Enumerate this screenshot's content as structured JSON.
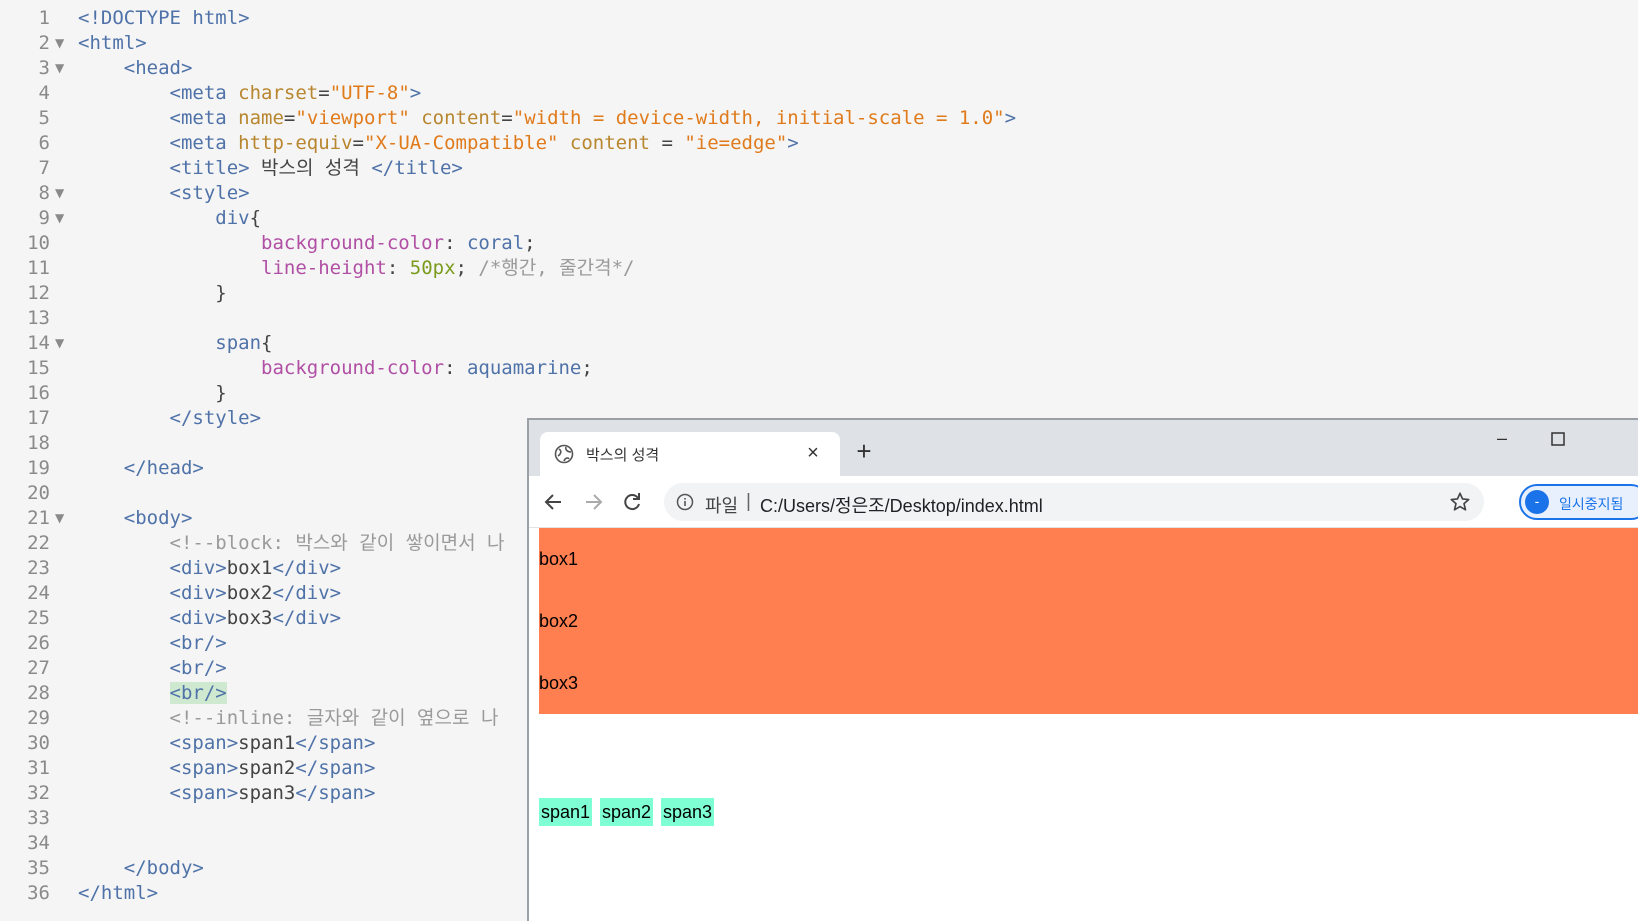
{
  "editor": {
    "lines": [
      {
        "num": "1",
        "fold": "",
        "parts": [
          [
            "t-tag",
            "<!DOCTYPE html>"
          ]
        ]
      },
      {
        "num": "2",
        "fold": "▼",
        "parts": [
          [
            "t-tag",
            "<html>"
          ]
        ]
      },
      {
        "num": "3",
        "fold": "▼",
        "parts": [
          [
            "t-txt",
            "    "
          ],
          [
            "t-tag",
            "<head>"
          ]
        ]
      },
      {
        "num": "4",
        "fold": "",
        "parts": [
          [
            "t-txt",
            "        "
          ],
          [
            "t-tag",
            "<meta "
          ],
          [
            "t-attr",
            "charset"
          ],
          [
            "t-txt",
            "="
          ],
          [
            "t-str",
            "\"UTF-8\""
          ],
          [
            "t-tag",
            ">"
          ]
        ]
      },
      {
        "num": "5",
        "fold": "",
        "parts": [
          [
            "t-txt",
            "        "
          ],
          [
            "t-tag",
            "<meta "
          ],
          [
            "t-attr",
            "name"
          ],
          [
            "t-txt",
            "="
          ],
          [
            "t-str",
            "\"viewport\""
          ],
          [
            "t-txt",
            " "
          ],
          [
            "t-attr",
            "content"
          ],
          [
            "t-txt",
            "="
          ],
          [
            "t-str",
            "\"width = device-width, initial-scale = 1.0\""
          ],
          [
            "t-tag",
            ">"
          ]
        ]
      },
      {
        "num": "6",
        "fold": "",
        "parts": [
          [
            "t-txt",
            "        "
          ],
          [
            "t-tag",
            "<meta "
          ],
          [
            "t-attr",
            "http-equiv"
          ],
          [
            "t-txt",
            "="
          ],
          [
            "t-str",
            "\"X-UA-Compatible\""
          ],
          [
            "t-txt",
            " "
          ],
          [
            "t-attr",
            "content"
          ],
          [
            "t-txt",
            " = "
          ],
          [
            "t-str",
            "\"ie=edge\""
          ],
          [
            "t-tag",
            ">"
          ]
        ]
      },
      {
        "num": "7",
        "fold": "",
        "parts": [
          [
            "t-txt",
            "        "
          ],
          [
            "t-tag",
            "<title>"
          ],
          [
            "t-txt",
            " 박스의 성격 "
          ],
          [
            "t-tag",
            "</title>"
          ]
        ]
      },
      {
        "num": "8",
        "fold": "▼",
        "parts": [
          [
            "t-txt",
            "        "
          ],
          [
            "t-tag",
            "<style>"
          ]
        ]
      },
      {
        "num": "9",
        "fold": "▼",
        "parts": [
          [
            "t-txt",
            "            "
          ],
          [
            "t-sel",
            "div"
          ],
          [
            "t-txt",
            "{"
          ]
        ]
      },
      {
        "num": "10",
        "fold": "",
        "parts": [
          [
            "t-txt",
            "                "
          ],
          [
            "t-prop",
            "background-color"
          ],
          [
            "t-txt",
            ": "
          ],
          [
            "t-val",
            "coral"
          ],
          [
            "t-txt",
            ";"
          ]
        ]
      },
      {
        "num": "11",
        "fold": "",
        "parts": [
          [
            "t-txt",
            "                "
          ],
          [
            "t-prop",
            "line-height"
          ],
          [
            "t-txt",
            ": "
          ],
          [
            "t-num",
            "50px"
          ],
          [
            "t-txt",
            "; "
          ],
          [
            "t-com",
            "/*행간, 줄간격*/"
          ]
        ]
      },
      {
        "num": "12",
        "fold": "",
        "parts": [
          [
            "t-txt",
            "            }"
          ]
        ]
      },
      {
        "num": "13",
        "fold": "",
        "parts": [
          [
            "t-txt",
            ""
          ]
        ]
      },
      {
        "num": "14",
        "fold": "▼",
        "parts": [
          [
            "t-txt",
            "            "
          ],
          [
            "t-sel",
            "span"
          ],
          [
            "t-txt",
            "{"
          ]
        ]
      },
      {
        "num": "15",
        "fold": "",
        "parts": [
          [
            "t-txt",
            "                "
          ],
          [
            "t-prop",
            "background-color"
          ],
          [
            "t-txt",
            ": "
          ],
          [
            "t-val",
            "aquamarine"
          ],
          [
            "t-txt",
            ";"
          ]
        ]
      },
      {
        "num": "16",
        "fold": "",
        "parts": [
          [
            "t-txt",
            "            }"
          ]
        ]
      },
      {
        "num": "17",
        "fold": "",
        "parts": [
          [
            "t-txt",
            "        "
          ],
          [
            "t-tag",
            "</style>"
          ]
        ]
      },
      {
        "num": "18",
        "fold": "",
        "parts": [
          [
            "t-txt",
            ""
          ]
        ]
      },
      {
        "num": "19",
        "fold": "",
        "parts": [
          [
            "t-txt",
            "    "
          ],
          [
            "t-tag",
            "</head>"
          ]
        ]
      },
      {
        "num": "20",
        "fold": "",
        "parts": [
          [
            "t-txt",
            ""
          ]
        ]
      },
      {
        "num": "21",
        "fold": "▼",
        "parts": [
          [
            "t-txt",
            "    "
          ],
          [
            "t-tag",
            "<body>"
          ]
        ]
      },
      {
        "num": "22",
        "fold": "",
        "parts": [
          [
            "t-txt",
            "        "
          ],
          [
            "t-com",
            "<!--block: 박스와 같이 쌓이면서 나"
          ]
        ]
      },
      {
        "num": "23",
        "fold": "",
        "parts": [
          [
            "t-txt",
            "        "
          ],
          [
            "t-tag",
            "<div>"
          ],
          [
            "t-txt",
            "box1"
          ],
          [
            "t-tag",
            "</div>"
          ]
        ]
      },
      {
        "num": "24",
        "fold": "",
        "parts": [
          [
            "t-txt",
            "        "
          ],
          [
            "t-tag",
            "<div>"
          ],
          [
            "t-txt",
            "box2"
          ],
          [
            "t-tag",
            "</div>"
          ]
        ]
      },
      {
        "num": "25",
        "fold": "",
        "parts": [
          [
            "t-txt",
            "        "
          ],
          [
            "t-tag",
            "<div>"
          ],
          [
            "t-txt",
            "box3"
          ],
          [
            "t-tag",
            "</div>"
          ]
        ]
      },
      {
        "num": "26",
        "fold": "",
        "parts": [
          [
            "t-txt",
            "        "
          ],
          [
            "t-tag",
            "<br/>"
          ]
        ]
      },
      {
        "num": "27",
        "fold": "",
        "parts": [
          [
            "t-txt",
            "        "
          ],
          [
            "t-tag",
            "<br/>"
          ]
        ]
      },
      {
        "num": "28",
        "fold": "",
        "parts": [
          [
            "t-txt",
            "        "
          ],
          [
            "t-tag hl",
            "<br/>"
          ]
        ]
      },
      {
        "num": "29",
        "fold": "",
        "parts": [
          [
            "t-txt",
            "        "
          ],
          [
            "t-com",
            "<!--inline: 글자와 같이 옆으로 나"
          ]
        ]
      },
      {
        "num": "30",
        "fold": "",
        "parts": [
          [
            "t-txt",
            "        "
          ],
          [
            "t-tag",
            "<span>"
          ],
          [
            "t-txt",
            "span1"
          ],
          [
            "t-tag",
            "</span>"
          ]
        ]
      },
      {
        "num": "31",
        "fold": "",
        "parts": [
          [
            "t-txt",
            "        "
          ],
          [
            "t-tag",
            "<span>"
          ],
          [
            "t-txt",
            "span2"
          ],
          [
            "t-tag",
            "</span>"
          ]
        ]
      },
      {
        "num": "32",
        "fold": "",
        "parts": [
          [
            "t-txt",
            "        "
          ],
          [
            "t-tag",
            "<span>"
          ],
          [
            "t-txt",
            "span3"
          ],
          [
            "t-tag",
            "</span>"
          ]
        ]
      },
      {
        "num": "33",
        "fold": "",
        "parts": [
          [
            "t-txt",
            ""
          ]
        ]
      },
      {
        "num": "34",
        "fold": "",
        "parts": [
          [
            "t-txt",
            ""
          ]
        ]
      },
      {
        "num": "35",
        "fold": "",
        "parts": [
          [
            "t-txt",
            "    "
          ],
          [
            "t-tag",
            "</body>"
          ]
        ]
      },
      {
        "num": "36",
        "fold": "",
        "parts": [
          [
            "t-tag",
            "</html>"
          ]
        ]
      }
    ]
  },
  "browser": {
    "tab": {
      "title": "박스의 성격",
      "close_symbol": "×"
    },
    "new_tab_symbol": "+",
    "minimize_symbol": "–",
    "address": {
      "scheme_label": "파일",
      "separator": "|",
      "url": "C:/Users/정은조/Desktop/index.html"
    },
    "profile": {
      "symbol": "-",
      "label": "일시중지됨"
    },
    "page": {
      "divs": [
        "box1",
        "box2",
        "box3"
      ],
      "spans": [
        "span1",
        "span2",
        "span3"
      ],
      "div_color": "coral",
      "span_color": "aquamarine"
    }
  },
  "colors": {
    "tag": "#4f72a8",
    "attr": "#b8862f",
    "string": "#e07b1c",
    "property": "#b04fa4",
    "number": "#7a9b1b",
    "comment": "#9a9a9a",
    "accent": "#1a73e8"
  },
  "icons": {
    "tab_favicon": "globe-icon",
    "back": "arrow-left-icon",
    "forward": "arrow-right-icon",
    "reload": "reload-icon",
    "site_info": "info-icon",
    "bookmark": "star-icon",
    "maximize": "maximize-icon"
  }
}
